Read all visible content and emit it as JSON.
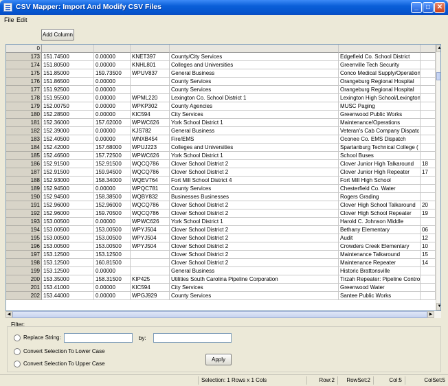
{
  "window": {
    "title": "CSV Mapper: Import And Modify CSV Files"
  },
  "menu": [
    {
      "label": "File"
    },
    {
      "label": "Edit"
    }
  ],
  "toolbar": {
    "add_column_label": "Add Column"
  },
  "grid": {
    "header_row_number": "0",
    "rows": [
      [
        "173",
        "151.74500",
        "0.00000",
        "KNET397",
        "County/City Services",
        "Edgefield Co. School District",
        ""
      ],
      [
        "174",
        "151.80500",
        "0.00000",
        "KNHL801",
        "Colleges and Universities",
        "Greenville Tech Security",
        ""
      ],
      [
        "175",
        "151.85000",
        "159.73500",
        "WPUV837",
        "General Business",
        "Conco Medical Supply/Operation",
        ""
      ],
      [
        "176",
        "151.86500",
        "0.00000",
        "",
        "County Services",
        "Orangeburg Regional Hospital",
        ""
      ],
      [
        "177",
        "151.92500",
        "0.00000",
        "",
        "County Services",
        "Orangeburg Regional Hospital",
        ""
      ],
      [
        "178",
        "151.95500",
        "0.00000",
        "WPML220",
        "Lexington Co. School District 1",
        "Lexington High School/Lexington",
        ""
      ],
      [
        "179",
        "152.00750",
        "0.00000",
        "WPKP302",
        "County Agencies",
        "MUSC Paging",
        ""
      ],
      [
        "180",
        "152.28500",
        "0.00000",
        "KIC594",
        "City Services",
        "Greenwood Public Works",
        ""
      ],
      [
        "181",
        "152.36000",
        "157.62000",
        "WPWC626",
        "York School District 1",
        "Maintenance/Operations",
        ""
      ],
      [
        "182",
        "152.39000",
        "0.00000",
        "KJS782",
        "General Business",
        "Veteran's Cab Company Dispatc",
        ""
      ],
      [
        "183",
        "152.40500",
        "0.00000",
        "WNXB454",
        "Fire/EMS",
        "Oconee Co. EMS Dispatch",
        ""
      ],
      [
        "184",
        "152.42000",
        "157.68000",
        "WPUJ223",
        "Colleges and Universities",
        "Spartanburg Technical College (",
        ""
      ],
      [
        "185",
        "152.46500",
        "157.72500",
        "WPWC626",
        "York School District 1",
        "School Buses",
        ""
      ],
      [
        "186",
        "152.91500",
        "152.91500",
        "WQCQ786",
        "Clover School District 2",
        "Clover Junior High Talkaround",
        "18"
      ],
      [
        "187",
        "152.91500",
        "159.94500",
        "WQCQ786",
        "Clover School District 2",
        "Clover Junior High Repeater",
        "17"
      ],
      [
        "188",
        "152.93000",
        "158.34000",
        "WQEV764",
        "Fort Mill School District 4",
        "Fort Mill High School",
        ""
      ],
      [
        "189",
        "152.94500",
        "0.00000",
        "WPQC781",
        "County Services",
        "Chesterfield Co. Water",
        ""
      ],
      [
        "190",
        "152.94500",
        "158.38500",
        "WQBY832",
        "Businesses Businesses",
        "Rogers Grading",
        ""
      ],
      [
        "191",
        "152.96000",
        "152.96000",
        "WQCQ786",
        "Clover School District 2",
        "Clover High School Talkaround",
        "20"
      ],
      [
        "192",
        "152.96000",
        "159.70500",
        "WQCQ786",
        "Clover School District 2",
        "Clover High School Repeater",
        "19"
      ],
      [
        "193",
        "153.00500",
        "0.00000",
        "WPWC626",
        "York School District 1",
        "Harold C. Johnson Middle",
        ""
      ],
      [
        "194",
        "153.00500",
        "153.00500",
        "WPYJ504",
        "Clover School District 2",
        "Bethany Elementary",
        "06"
      ],
      [
        "195",
        "153.00500",
        "153.00500",
        "WPYJ504",
        "Clover School District 2",
        "Audit",
        "12"
      ],
      [
        "196",
        "153.00500",
        "153.00500",
        "WPYJ504",
        "Clover School District 2",
        "Crowders Creek Elementary",
        "10"
      ],
      [
        "197",
        "153.12500",
        "153.12500",
        "",
        "Clover School District 2",
        "Maintenance Talkaround",
        "15"
      ],
      [
        "198",
        "153.12500",
        "160.81500",
        "",
        "Clover School District 2",
        "Maintenance Repeater",
        "14"
      ],
      [
        "199",
        "153.12500",
        "0.00000",
        "",
        "General Business",
        "Historic Brattonsville",
        ""
      ],
      [
        "200",
        "153.35000",
        "158.31500",
        "KIP425",
        "Utilities South Carolina Pipeline Corporation",
        "Tirzah Repeater: Pipeline Control",
        ""
      ],
      [
        "201",
        "153.41000",
        "0.00000",
        "KIC594",
        "City Services",
        "Greenwood Water",
        ""
      ],
      [
        "202",
        "153.44000",
        "0.00000",
        "WPGJ929",
        "County Services",
        "Santee Public Works",
        ""
      ]
    ]
  },
  "filter": {
    "group_label": "Filter:",
    "replace_label": "Replace String:",
    "by_label": "by:",
    "replace_value": "",
    "by_value": "",
    "lower_label": "Convert Selection To Lower Case",
    "upper_label": "Convert Selection To Upper Case",
    "apply_label": "Apply"
  },
  "status": {
    "selection": "Selection: 1 Rows x 1 Cols",
    "row": "Row:2",
    "rowset": "RowSet:2",
    "col": "Col:5",
    "colset": "ColSet:5"
  },
  "icons": {
    "scroll_up": "up-arrow-icon",
    "scroll_down": "down-arrow-icon",
    "scroll_left": "left-arrow-icon",
    "scroll_right": "right-arrow-icon"
  }
}
